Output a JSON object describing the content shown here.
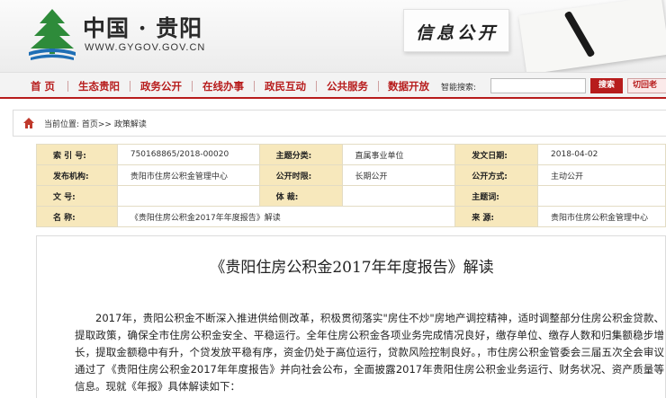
{
  "header": {
    "site_title": "中国 · 贵阳",
    "site_url": "WWW.GYGOV.GOV.CN",
    "section_title": "信息公开"
  },
  "nav": {
    "items": [
      "首  页",
      "生态贵阳",
      "政务公开",
      "在线办事",
      "政民互动",
      "公共服务",
      "数据开放"
    ],
    "search_label": "智能搜索:",
    "search_placeholder": "",
    "search_button": "搜索",
    "old_version_link": "切回老"
  },
  "breadcrumb": {
    "text": "当前位置:  首页>> 政策解读"
  },
  "meta": {
    "row1": {
      "k1": "索 引 号:",
      "v1": "750168865/2018-00020",
      "k2": "主题分类:",
      "v2": "直属事业单位",
      "k3": "发文日期:",
      "v3": "2018-04-02"
    },
    "row2": {
      "k1": "发布机构:",
      "v1": "贵阳市住房公积金管理中心",
      "k2": "公开时限:",
      "v2": "长期公开",
      "k3": "公开方式:",
      "v3": "主动公开"
    },
    "row3": {
      "k1": "文 号:",
      "v1": "",
      "k2": "体 裁:",
      "v2": "",
      "k3": "主题词:",
      "v3": ""
    },
    "row4": {
      "k1": "名 称:",
      "v1": "《贵阳住房公积金2017年年度报告》解读",
      "k3": "来 源:",
      "v3": "贵阳市住房公积金管理中心"
    }
  },
  "article": {
    "title": "《贵阳住房公积金2017年年度报告》解读",
    "body": "2017年，贵阳公积金不断深入推进供给侧改革，积极贯彻落实\"房住不炒\"房地产调控精神，适时调整部分住房公积金贷款、提取政策，确保全市住房公积金安全、平稳运行。全年住房公积金各项业务完成情况良好，缴存单位、缴存人数和归集额稳步增长，提取金额稳中有升，个贷发放平稳有序，资金仍处于高位运行，贷款风险控制良好。，市住房公积金管委会三届五次全会审议通过了《贵阳住房公积金2017年年度报告》并向社会公布，全面披露2017年贵阳住房公积金业务运行、财务状况、资产质量等信息。现就《年报》具体解读如下："
  },
  "colors": {
    "brand_red": "#b71c1c",
    "logo_green": "#2e8b3a",
    "meta_label_bg": "#f7e8bc"
  }
}
